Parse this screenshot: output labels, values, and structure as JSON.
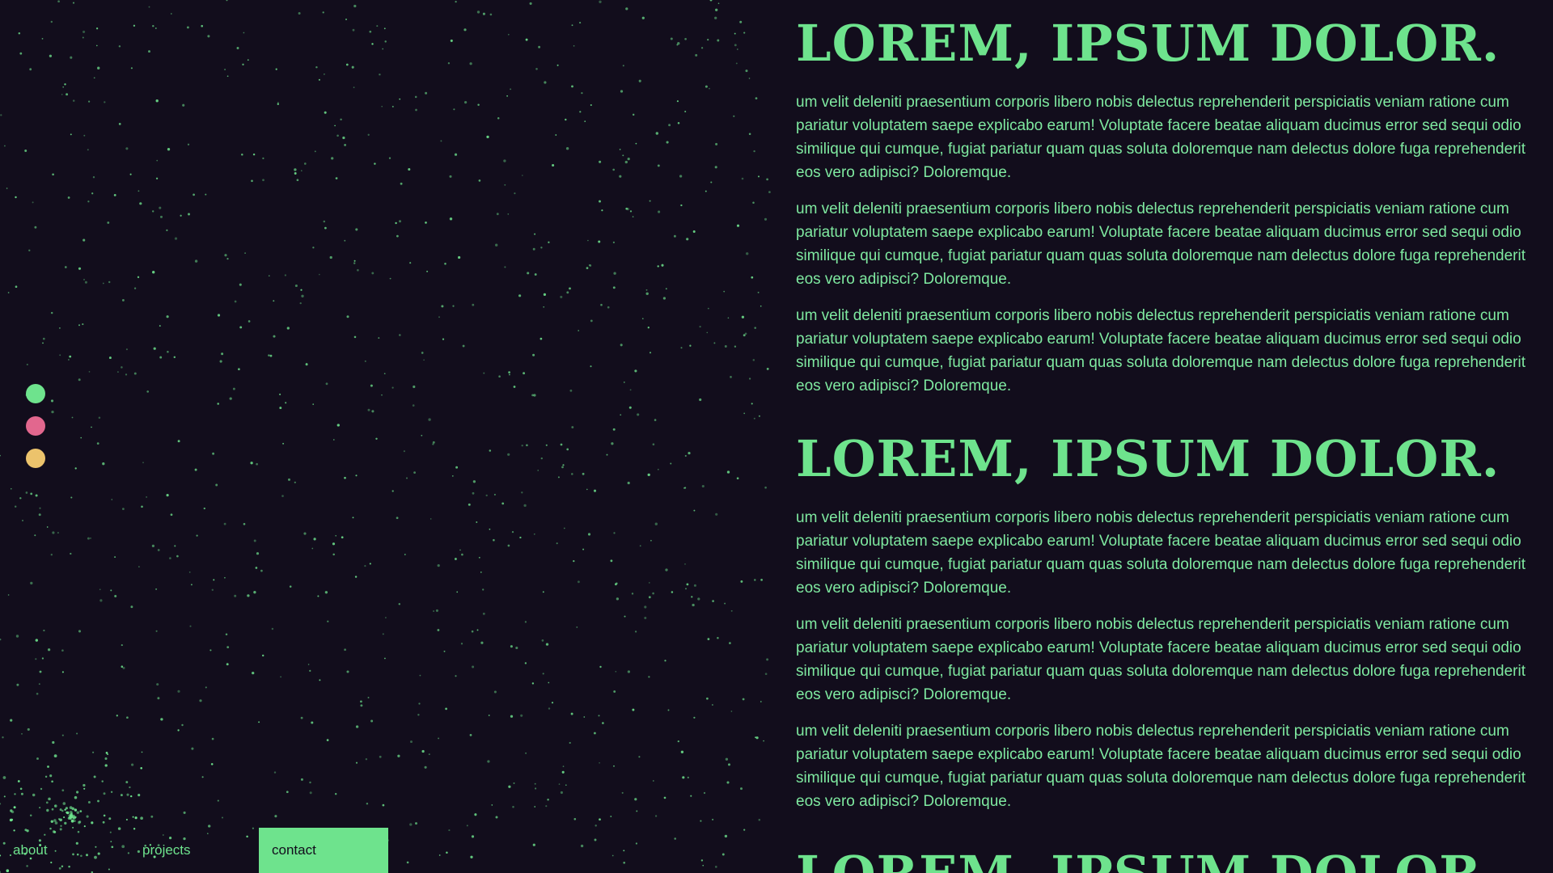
{
  "theme": {
    "background": "#120d1c",
    "accent": "#6ee38d",
    "star": "#6ee38d"
  },
  "color_switcher": [
    {
      "name": "green",
      "color": "#6ee38d"
    },
    {
      "name": "pink",
      "color": "#e2678e"
    },
    {
      "name": "yellow",
      "color": "#ecc36c"
    }
  ],
  "nav": {
    "about": "about",
    "projects": "projects",
    "contact": "contact",
    "active": "contact"
  },
  "sections": [
    {
      "heading": "LOREM, IPSUM DOLOR.",
      "paragraphs": [
        "um velit deleniti praesentium corporis libero nobis delectus reprehenderit perspiciatis veniam ratione cum pariatur voluptatem saepe explicabo earum! Voluptate facere beatae aliquam ducimus error sed sequi odio similique qui cumque, fugiat pariatur quam quas soluta doloremque nam delectus dolore fuga reprehenderit eos vero adipisci? Doloremque.",
        "um velit deleniti praesentium corporis libero nobis delectus reprehenderit perspiciatis veniam ratione cum pariatur voluptatem saepe explicabo earum! Voluptate facere beatae aliquam ducimus error sed sequi odio similique qui cumque, fugiat pariatur quam quas soluta doloremque nam delectus dolore fuga reprehenderit eos vero adipisci? Doloremque.",
        "um velit deleniti praesentium corporis libero nobis delectus reprehenderit perspiciatis veniam ratione cum pariatur voluptatem saepe explicabo earum! Voluptate facere beatae aliquam ducimus error sed sequi odio similique qui cumque, fugiat pariatur quam quas soluta doloremque nam delectus dolore fuga reprehenderit eos vero adipisci? Doloremque."
      ]
    },
    {
      "heading": "LOREM, IPSUM DOLOR.",
      "paragraphs": [
        "um velit deleniti praesentium corporis libero nobis delectus reprehenderit perspiciatis veniam ratione cum pariatur voluptatem saepe explicabo earum! Voluptate facere beatae aliquam ducimus error sed sequi odio similique qui cumque, fugiat pariatur quam quas soluta doloremque nam delectus dolore fuga reprehenderit eos vero adipisci? Doloremque.",
        "um velit deleniti praesentium corporis libero nobis delectus reprehenderit perspiciatis veniam ratione cum pariatur voluptatem saepe explicabo earum! Voluptate facere beatae aliquam ducimus error sed sequi odio similique qui cumque, fugiat pariatur quam quas soluta doloremque nam delectus dolore fuga reprehenderit eos vero adipisci? Doloremque.",
        "um velit deleniti praesentium corporis libero nobis delectus reprehenderit perspiciatis veniam ratione cum pariatur voluptatem saepe explicabo earum! Voluptate facere beatae aliquam ducimus error sed sequi odio similique qui cumque, fugiat pariatur quam quas soluta doloremque nam delectus dolore fuga reprehenderit eos vero adipisci? Doloremque."
      ]
    },
    {
      "heading": "LOREM, IPSUM DOLOR.",
      "paragraphs": []
    }
  ]
}
